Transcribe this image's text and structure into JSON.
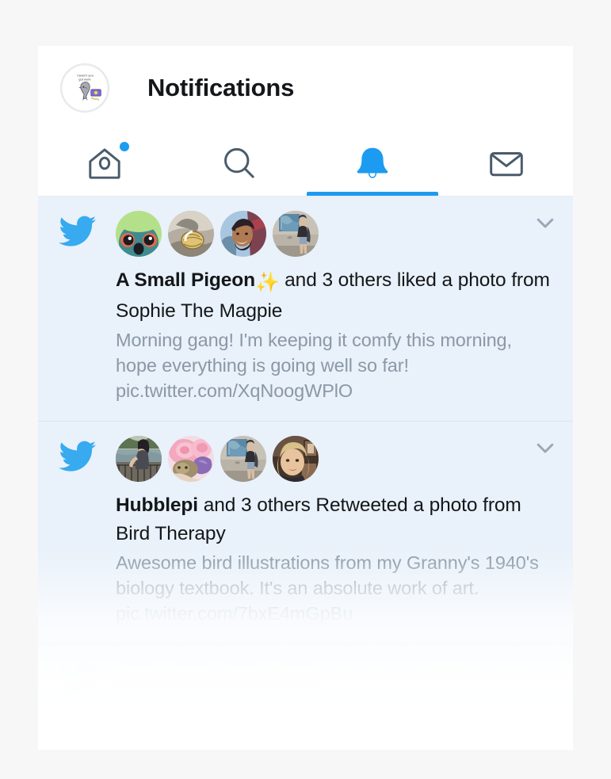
{
  "app": {
    "title": "Notifications",
    "accent_color": "#1d9bf0",
    "card_background": "#ffffff",
    "page_background": "#f7f7f8",
    "notification_row_background": "#e9f1fa",
    "muted_text_color": "#8b98a5"
  },
  "header": {
    "avatar": {
      "name": "profile-avatar",
      "description": "cartoon pigeon with speech bubble and purple wallet",
      "caption": "haven't you got work"
    },
    "title": "Notifications"
  },
  "tabs": [
    {
      "id": "home",
      "icon": "home-icon",
      "label": "Home",
      "active": false,
      "badge": true
    },
    {
      "id": "search",
      "icon": "search-icon",
      "label": "Search",
      "active": false,
      "badge": false
    },
    {
      "id": "notifications",
      "icon": "bell-icon",
      "label": "Notifications",
      "active": true,
      "badge": false
    },
    {
      "id": "messages",
      "icon": "envelope-icon",
      "label": "Messages",
      "active": false,
      "badge": false
    }
  ],
  "notifications": [
    {
      "type_icon": "twitter-bird-icon",
      "chevron_icon": "chevron-down-icon",
      "actor": "A Small Pigeon",
      "actor_emoji": "✨",
      "headline_rest": " and 3 others liked a photo from Sophie The Magpie",
      "preview": "Morning gang! I'm keeping it comfy this morning, hope everything is going well so far! pic.twitter.com/XqNoogWPlO",
      "avatars": [
        {
          "name": "avatar-green-bird",
          "alt": "green and teal cartoon bird face"
        },
        {
          "name": "avatar-snail-shell",
          "alt": "close-up of a snail shell on rock"
        },
        {
          "name": "avatar-illustration",
          "alt": "illustrated smiling bearded man"
        },
        {
          "name": "avatar-wall-person",
          "alt": "person standing by a painted wall"
        }
      ]
    },
    {
      "type_icon": "twitter-bird-icon",
      "chevron_icon": "chevron-down-icon",
      "actor": "Hubblepi",
      "actor_emoji": "",
      "headline_rest": " and 3 others Retweeted a photo from Bird Therapy",
      "preview": "Awesome bird illustrations from my Granny's 1940's biology textbook. It's an absolute work of art. pic.twitter.com/7bxE4mGpBu",
      "avatars": [
        {
          "name": "avatar-riverside",
          "alt": "person on a riverside walkway"
        },
        {
          "name": "avatar-pink-flowers",
          "alt": "pink flowers and cat"
        },
        {
          "name": "avatar-wall-person",
          "alt": "person standing by a painted wall"
        },
        {
          "name": "avatar-blonde-woman",
          "alt": "smiling blonde woman indoors"
        }
      ]
    },
    {
      "type_icon": "twitter-bird-icon",
      "chevron_icon": "chevron-down-icon",
      "actor": "",
      "actor_emoji": "",
      "headline_rest": "",
      "preview": "",
      "avatars": [
        {
          "name": "avatar-faded-1",
          "alt": "faded avatar"
        },
        {
          "name": "avatar-faded-2",
          "alt": "faded avatar"
        },
        {
          "name": "avatar-faded-3",
          "alt": "faded avatar"
        },
        {
          "name": "avatar-faded-4",
          "alt": "faded avatar"
        }
      ]
    }
  ]
}
